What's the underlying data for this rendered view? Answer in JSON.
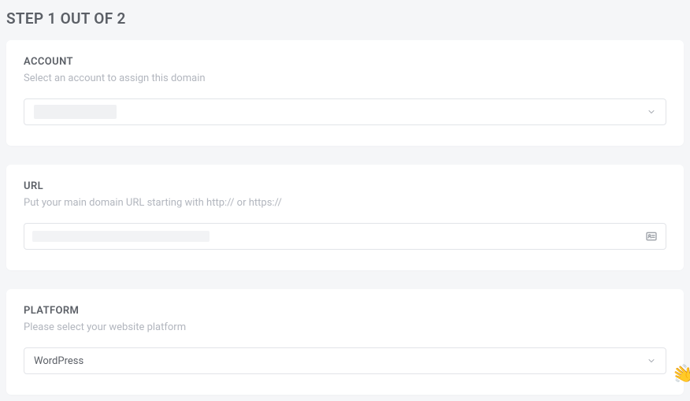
{
  "header": {
    "title": "STEP 1 OUT OF 2"
  },
  "account": {
    "title": "ACCOUNT",
    "subtitle": "Select an account to assign this domain",
    "value": ""
  },
  "url": {
    "title": "URL",
    "subtitle": "Put your main domain URL starting with http:// or https://",
    "value": ""
  },
  "platform": {
    "title": "PLATFORM",
    "subtitle": "Please select your website platform",
    "value": "WordPress"
  }
}
